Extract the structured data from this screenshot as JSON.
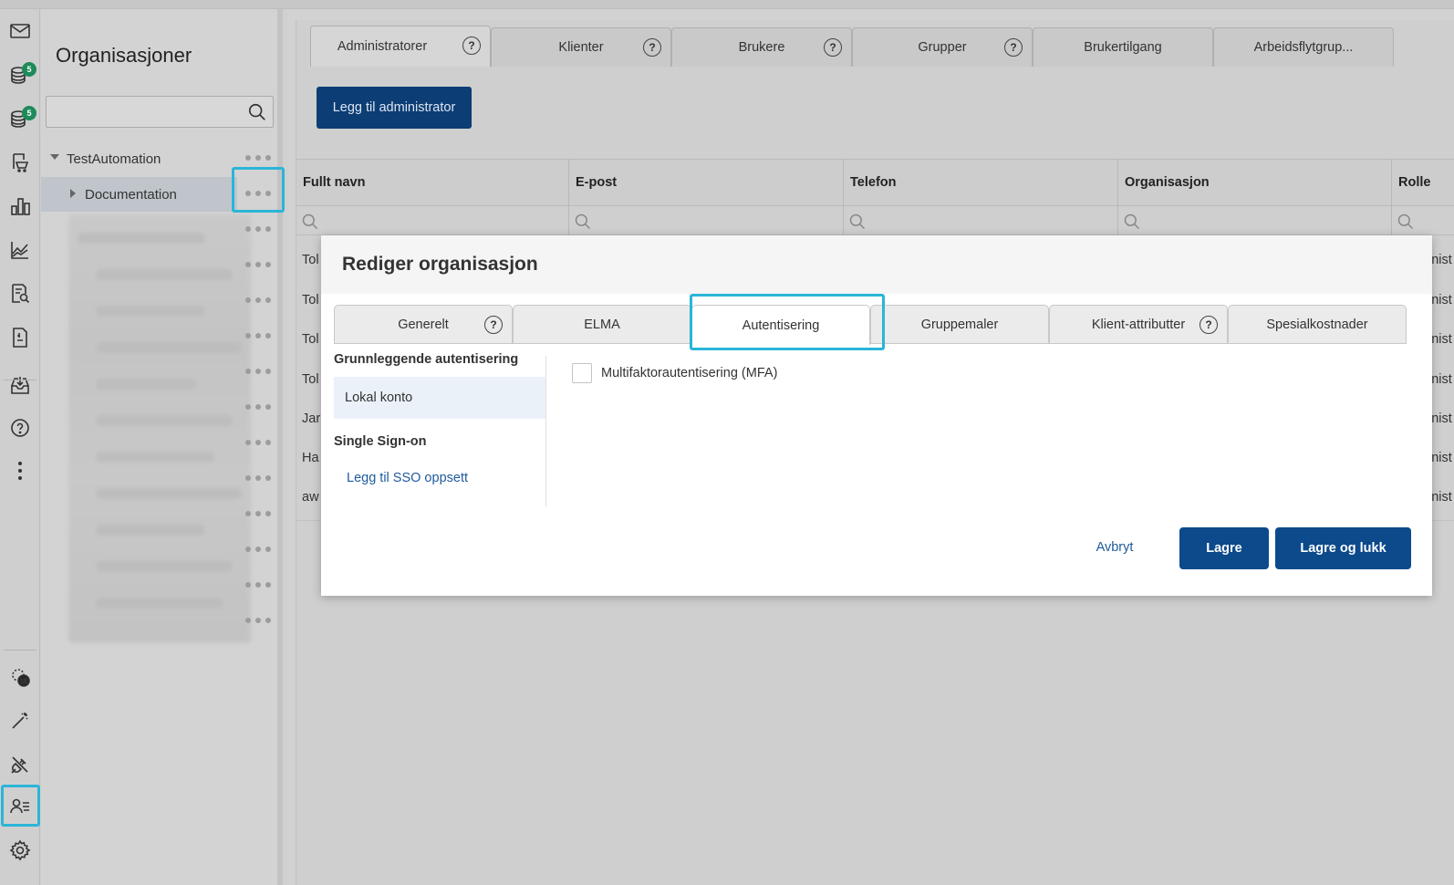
{
  "org_panel": {
    "title": "Organisasjoner",
    "search_placeholder": "",
    "tree": [
      {
        "label": "TestAutomation"
      },
      {
        "label": "Documentation"
      }
    ]
  },
  "main_tabs": [
    {
      "label": "Administratorer",
      "help": "?"
    },
    {
      "label": "Klienter",
      "help": "?"
    },
    {
      "label": "Brukere",
      "help": "?"
    },
    {
      "label": "Grupper",
      "help": "?"
    },
    {
      "label": "Brukertilgang"
    },
    {
      "label": "Arbeidsflytgrup..."
    }
  ],
  "add_admin_button": "Legg til administrator",
  "grid": {
    "columns": [
      "Fullt navn",
      "E-post",
      "Telefon",
      "Organisasjon",
      "Rolle"
    ],
    "row_prefixes": [
      "Tol",
      "Tol",
      "Tol",
      "Tol",
      "Jar",
      "Ha",
      "aw"
    ],
    "row_suffixes": [
      "inist",
      "inist",
      "inist",
      "inist",
      "inist",
      "inist",
      "inist"
    ]
  },
  "rail": {
    "badges": [
      "5",
      "5"
    ]
  },
  "dialog": {
    "title": "Rediger organisasjon",
    "tabs": [
      {
        "label": "Generelt",
        "help": "?"
      },
      {
        "label": "ELMA"
      },
      {
        "label": "Autentisering"
      },
      {
        "label": "Gruppemaler"
      },
      {
        "label": "Klient-attributter",
        "help": "?"
      },
      {
        "label": "Spesialkostnader"
      }
    ],
    "side": {
      "basic_heading": "Grunnleggende autentisering",
      "local_account": "Lokal konto",
      "sso_heading": "Single Sign-on",
      "add_sso": "Legg til SSO oppsett"
    },
    "mfa_label": "Multifaktorautentisering (MFA)",
    "cancel": "Avbryt",
    "save": "Lagre",
    "save_close": "Lagre og lukk"
  },
  "colors": {
    "accent_highlight": "#2bb5d8",
    "primary_button": "#0c4a8c",
    "badge": "#1e8a5a",
    "link": "#1f5a9e"
  }
}
